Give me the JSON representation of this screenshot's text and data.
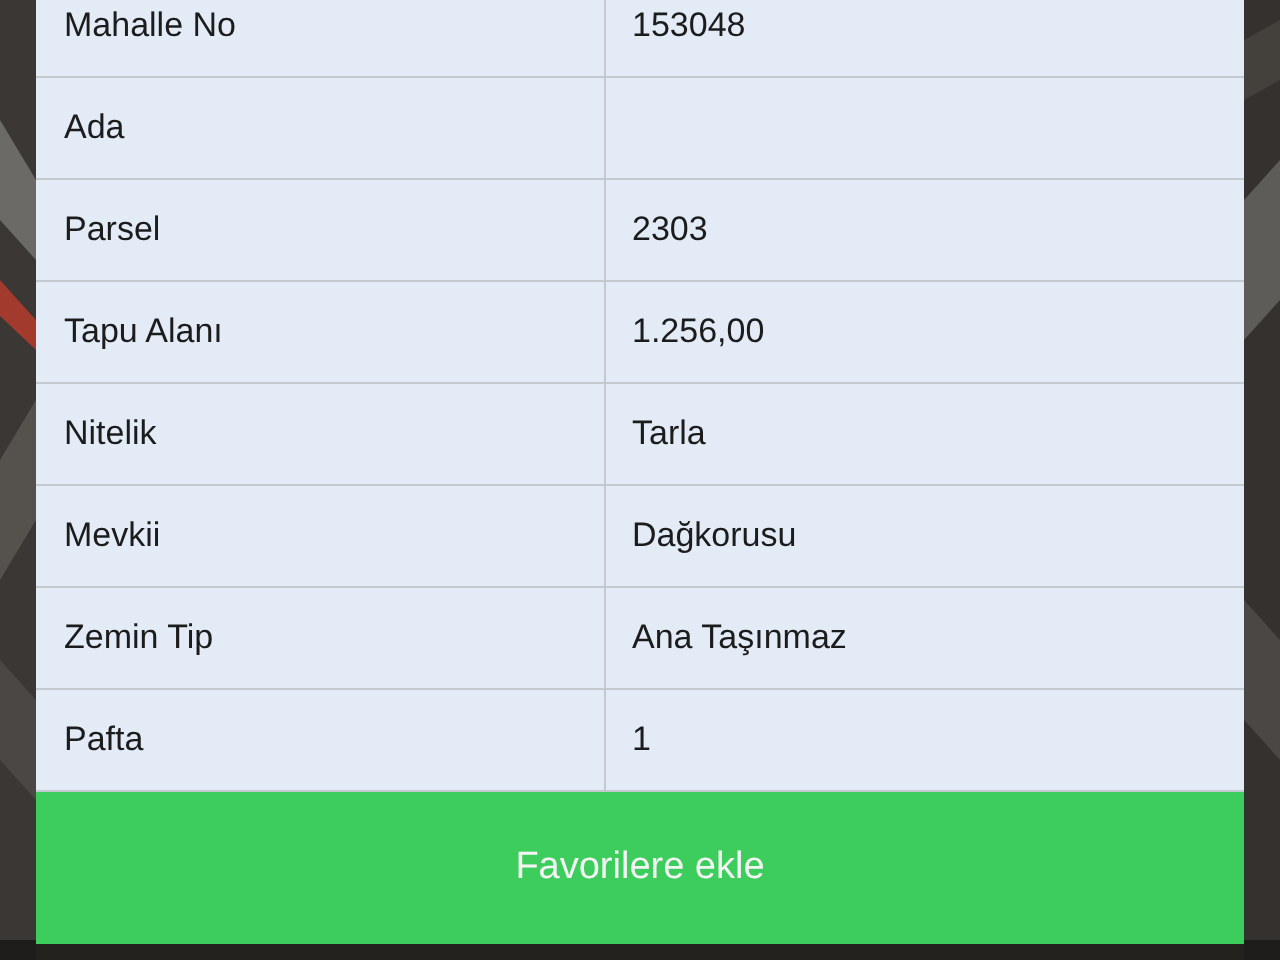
{
  "table": {
    "rows": [
      {
        "label": "Mahalle No",
        "value": "153048"
      },
      {
        "label": "Ada"
      },
      {
        "label": "Parsel",
        "value": "2303"
      },
      {
        "label": "Tapu Alanı",
        "value": "1.256,00"
      },
      {
        "label": "Nitelik",
        "value": "Tarla"
      },
      {
        "label": "Mevkii",
        "value": "Dağkorusu"
      },
      {
        "label": "Zemin Tip",
        "value": "Ana Taşınmaz"
      },
      {
        "label": "Pafta",
        "value": "1"
      }
    ]
  },
  "button": {
    "label": "Favorilere ekle"
  }
}
